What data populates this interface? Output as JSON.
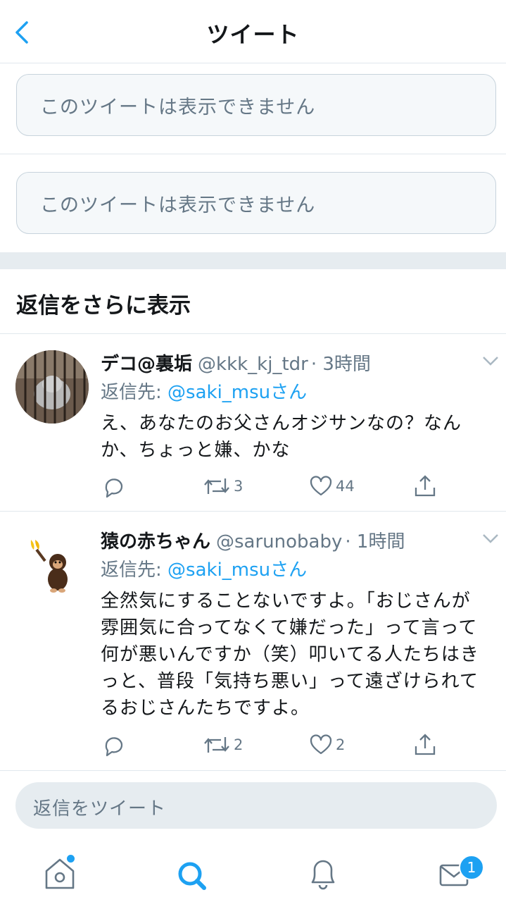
{
  "header": {
    "title": "ツイート"
  },
  "unavailable": [
    "このツイートは表示できません",
    "このツイートは表示できません"
  ],
  "more_replies": "返信をさらに表示",
  "tweets": [
    {
      "name": "デコ@裏垢",
      "handle": "@kkk_kj_tdr",
      "time": "· 3時間",
      "reply_label": "返信先: ",
      "reply_to": "@saki_msuさん",
      "text_lines": [
        "え、あなたのお父さんオジサンなの？なん",
        "か、ちょっと嫌、かな"
      ],
      "retweets": "3",
      "likes": "44"
    },
    {
      "name": "猿の赤ちゃん",
      "handle": "@sarunobaby",
      "time": "· 1時間",
      "reply_label": "返信先: ",
      "reply_to": "@saki_msuさん",
      "text_lines": [
        "全然気にすることないですよ。「おじさんが",
        "雰囲気に合ってなくて嫌だった」って言って",
        "何が悪いんですか（笑）叩いてる人たちはき",
        "っと、普段「気持ち悪い」って遠ざけられて",
        "るおじさんたちですよ。"
      ],
      "retweets": "2",
      "likes": "2"
    }
  ],
  "compose": {
    "placeholder": "返信をツイート"
  },
  "tabbar": {
    "messages_badge": "1"
  },
  "colors": {
    "accent": "#1da1f2",
    "text": "#14171a",
    "secondary": "#657786",
    "border": "#e1e8ed"
  }
}
